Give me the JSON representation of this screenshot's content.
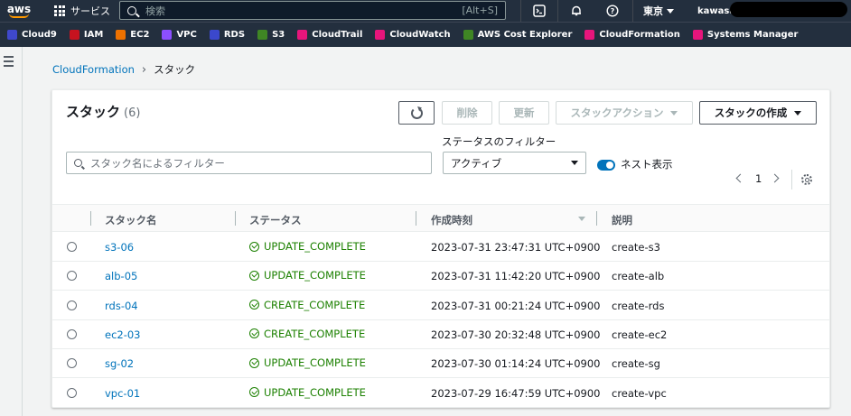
{
  "topnav": {
    "logo": "aws",
    "services_label": "サービス",
    "search_placeholder": "検索",
    "search_shortcut": "[Alt+S]",
    "region": "東京",
    "user": "kawasal"
  },
  "favorites": [
    {
      "label": "Cloud9",
      "color": "#3f48cc"
    },
    {
      "label": "IAM",
      "color": "#c7131f"
    },
    {
      "label": "EC2",
      "color": "#ed7100"
    },
    {
      "label": "VPC",
      "color": "#8c4fff"
    },
    {
      "label": "RDS",
      "color": "#3b48cc"
    },
    {
      "label": "S3",
      "color": "#3f8624"
    },
    {
      "label": "CloudTrail",
      "color": "#e7157b"
    },
    {
      "label": "CloudWatch",
      "color": "#e7157b"
    },
    {
      "label": "AWS Cost Explorer",
      "color": "#3f8624"
    },
    {
      "label": "CloudFormation",
      "color": "#e7157b"
    },
    {
      "label": "Systems Manager",
      "color": "#e7157b"
    }
  ],
  "breadcrumb": {
    "parent": "CloudFormation",
    "current": "スタック"
  },
  "panel": {
    "title": "スタック",
    "count": "(6)",
    "buttons": {
      "delete": "削除",
      "update": "更新",
      "stack_actions": "スタックアクション",
      "create_stack": "スタックの作成"
    },
    "filter_placeholder": "スタック名によるフィルター",
    "status_filter_label": "ステータスのフィルター",
    "status_filter_value": "アクティブ",
    "nested_toggle_label": "ネスト表示",
    "page": "1"
  },
  "table": {
    "headers": {
      "name": "スタック名",
      "status": "ステータス",
      "created": "作成時刻",
      "description": "説明"
    },
    "rows": [
      {
        "name": "s3-06",
        "status": "UPDATE_COMPLETE",
        "created": "2023-07-31 23:47:31 UTC+0900",
        "description": "create-s3"
      },
      {
        "name": "alb-05",
        "status": "UPDATE_COMPLETE",
        "created": "2023-07-31 11:42:20 UTC+0900",
        "description": "create-alb"
      },
      {
        "name": "rds-04",
        "status": "CREATE_COMPLETE",
        "created": "2023-07-31 00:21:24 UTC+0900",
        "description": "create-rds"
      },
      {
        "name": "ec2-03",
        "status": "CREATE_COMPLETE",
        "created": "2023-07-30 20:32:48 UTC+0900",
        "description": "create-ec2"
      },
      {
        "name": "sg-02",
        "status": "UPDATE_COMPLETE",
        "created": "2023-07-30 01:14:24 UTC+0900",
        "description": "create-sg"
      },
      {
        "name": "vpc-01",
        "status": "UPDATE_COMPLETE",
        "created": "2023-07-29 16:47:59 UTC+0900",
        "description": "create-vpc"
      }
    ]
  }
}
